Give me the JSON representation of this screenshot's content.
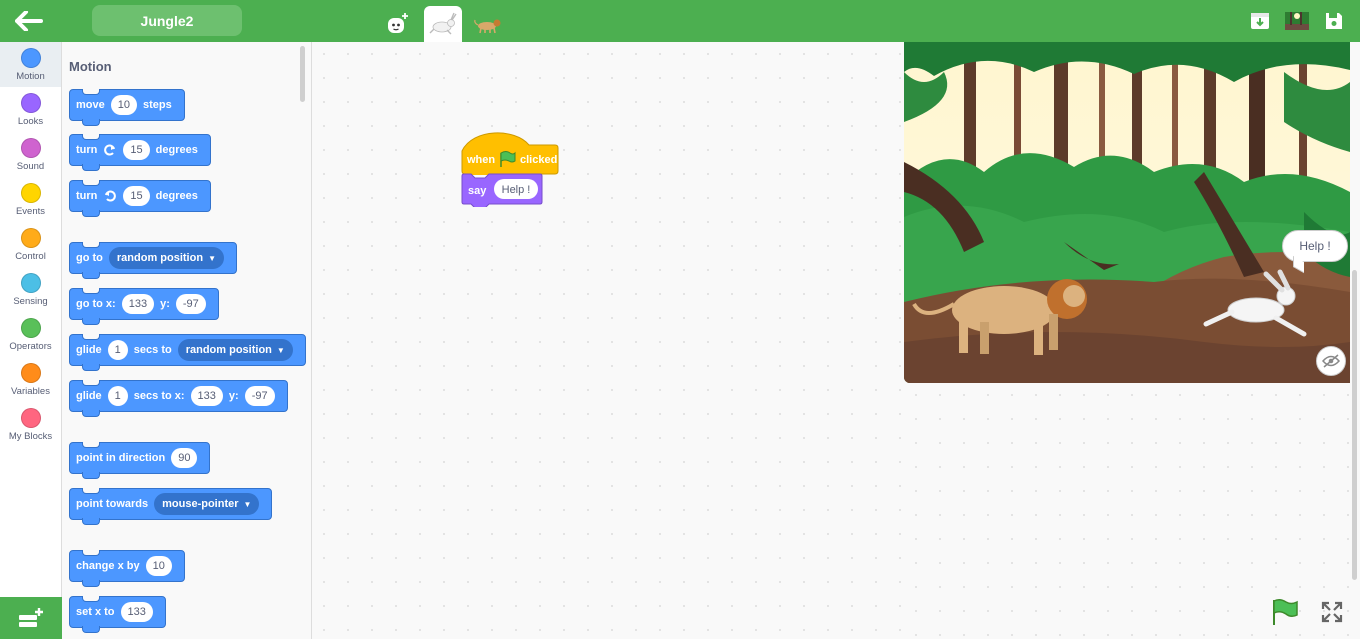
{
  "header": {
    "project_name": "Jungle2"
  },
  "categories": [
    {
      "label": "Motion",
      "color": "#4c97ff"
    },
    {
      "label": "Looks",
      "color": "#9966ff"
    },
    {
      "label": "Sound",
      "color": "#cf63cf"
    },
    {
      "label": "Events",
      "color": "#ffd500"
    },
    {
      "label": "Control",
      "color": "#ffab19"
    },
    {
      "label": "Sensing",
      "color": "#4cbfe6"
    },
    {
      "label": "Operators",
      "color": "#59c059"
    },
    {
      "label": "Variables",
      "color": "#ff8c1a"
    },
    {
      "label": "My Blocks",
      "color": "#ff6680"
    }
  ],
  "palette": {
    "title": "Motion",
    "move": {
      "w1": "move",
      "v1": "10",
      "w2": "steps"
    },
    "turn_right": {
      "w1": "turn",
      "v1": "15",
      "w2": "degrees"
    },
    "turn_left": {
      "w1": "turn",
      "v1": "15",
      "w2": "degrees"
    },
    "goto": {
      "w1": "go to",
      "d1": "random position"
    },
    "goto_xy": {
      "w1": "go to x:",
      "v1": "133",
      "w2": "y:",
      "v2": "-97"
    },
    "glide": {
      "w1": "glide",
      "v1": "1",
      "w2": "secs to",
      "d1": "random position"
    },
    "glide_xy": {
      "w1": "glide",
      "v1": "1",
      "w2": "secs to x:",
      "v2": "133",
      "w3": "y:",
      "v3": "-97"
    },
    "point_dir": {
      "w1": "point in direction",
      "v1": "90"
    },
    "point_towards": {
      "w1": "point towards",
      "d1": "mouse-pointer"
    },
    "change_x": {
      "w1": "change x by",
      "v1": "10"
    },
    "set_x": {
      "w1": "set x to",
      "v1": "133"
    }
  },
  "script": {
    "hat_when": "when",
    "hat_clicked": "clicked",
    "say_label": "say",
    "say_value": "Help !"
  },
  "stage": {
    "speech_text": "Help !"
  },
  "colors": {
    "accent": "#4caf50",
    "motion": "#4c97ff",
    "events": "#ffbf00",
    "looks": "#9966ff"
  }
}
